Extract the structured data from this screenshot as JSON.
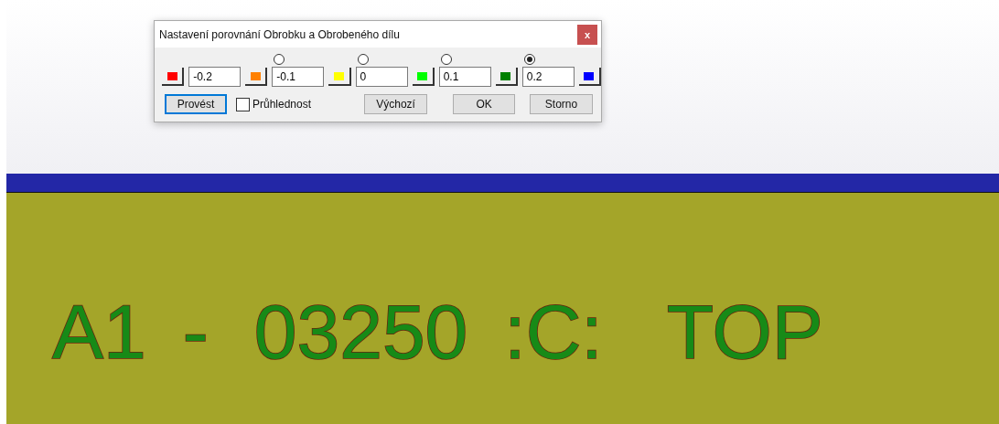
{
  "dialog": {
    "title": "Nastavení porovnání Obrobku a Obrobeného dílu",
    "close": "x",
    "color_buttons": [
      {
        "color": "#ff0000"
      },
      {
        "color": "#ff8000"
      },
      {
        "color": "#ffff00"
      },
      {
        "color": "#00ff00"
      },
      {
        "color": "#008000"
      },
      {
        "color": "#0000ff"
      }
    ],
    "thresholds": [
      {
        "kind": "plain",
        "value": "-0.2"
      },
      {
        "kind": "radio",
        "value": "-0.1",
        "selected": false
      },
      {
        "kind": "radio",
        "value": "0",
        "selected": false
      },
      {
        "kind": "radio",
        "value": "0.1",
        "selected": false
      },
      {
        "kind": "radio",
        "value": "0.2",
        "selected": true
      }
    ],
    "apply_button": {
      "label": "Provést",
      "focused": true
    },
    "transparency": {
      "label": "Průhlednost",
      "checked": false
    },
    "buttons": [
      "Výchozí",
      "OK",
      "Storno"
    ]
  },
  "canvas": {
    "engraving": [
      "A1",
      "-",
      "03250",
      ":C:",
      "TOP"
    ]
  }
}
